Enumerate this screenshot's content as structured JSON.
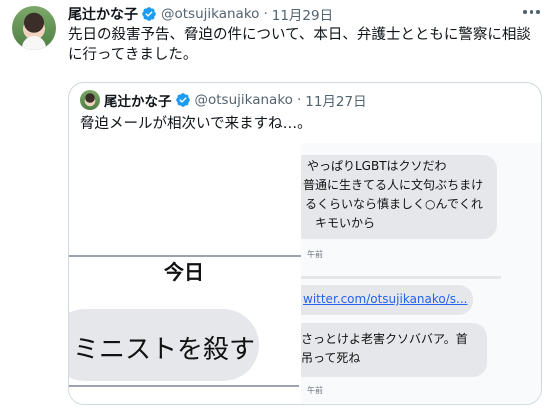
{
  "tweet": {
    "author_name": "尾辻かな子",
    "handle": "@otsujikanako",
    "separator": "·",
    "date": "11月29日",
    "text": "先日の殺害予告、脅迫の件について、本日、弁護士とともに警察に相談に行ってきました。"
  },
  "quoted_tweet": {
    "author_name": "尾辻かな子",
    "handle": "@otsujikanako",
    "separator": "·",
    "date": "11月27日",
    "text": "脅迫メールが相次いで来ますね…。"
  },
  "screenshot": {
    "day_label": "今日",
    "left_message": "ミニストを殺す",
    "message1_lines": [
      "やっぱりLGBTはクソだわ",
      "普通に生きてる人に文句ぶちまけ",
      "るくらいなら慎ましく○んでくれ",
      "キモいから"
    ],
    "message1_time": "午前",
    "link_text": "witter.com/otsujikanako/s...",
    "message2_lines": [
      "さっとけよ老害クソババア。首",
      "吊って死ね"
    ],
    "message2_time": "午前"
  },
  "colors": {
    "verified_badge": "#1d9bf0",
    "link": "#2563eb",
    "secondary_text": "#536471"
  },
  "icons": {
    "verified": "verified-badge-icon",
    "more": "more-options-icon"
  }
}
